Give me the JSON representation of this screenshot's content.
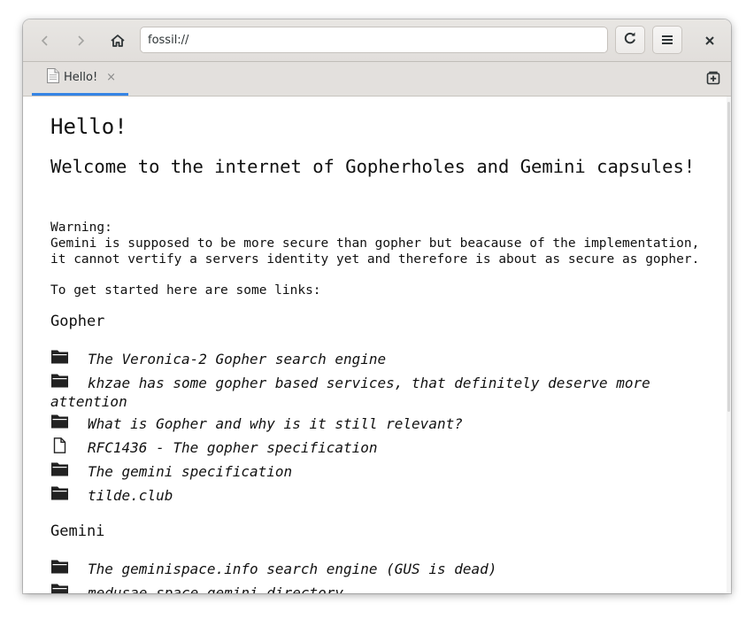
{
  "browser": {
    "url": "fossil://",
    "tab_label": "Hello!",
    "tab_close": "×",
    "accent_color": "#3584e4"
  },
  "page": {
    "heading": "Hello!",
    "subheading": "Welcome to the internet of Gopherholes and Gemini capsules!",
    "warning": "Warning:\nGemini is supposed to be more secure than gopher but beacause of the implementation,\nit cannot vertify a servers identity yet and therefore is about as secure as gopher.",
    "intro": "To get started here are some links:",
    "sections": [
      {
        "title": "Gopher",
        "links": [
          {
            "icon": "folder-icon",
            "label": "The Veronica-2 Gopher search engine"
          },
          {
            "icon": "folder-icon",
            "label": "khzae has some gopher based services, that definitely deserve more attention"
          },
          {
            "icon": "folder-icon",
            "label": "What is Gopher and why is it still relevant?"
          },
          {
            "icon": "document-icon",
            "label": "RFC1436 - The gopher specification"
          },
          {
            "icon": "folder-icon",
            "label": "The gemini specification"
          },
          {
            "icon": "folder-icon",
            "label": "tilde.club"
          }
        ]
      },
      {
        "title": "Gemini",
        "links": [
          {
            "icon": "folder-icon",
            "label": "The geminispace.info search engine (GUS is dead)"
          },
          {
            "icon": "folder-icon",
            "label": "medusae.space gemini directory"
          }
        ]
      }
    ]
  }
}
